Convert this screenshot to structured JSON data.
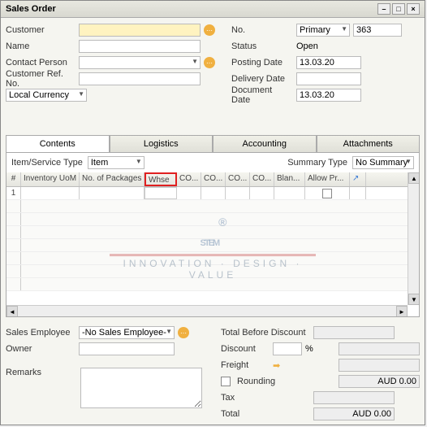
{
  "window": {
    "title": "Sales Order"
  },
  "header": {
    "left": {
      "customer_label": "Customer",
      "name_label": "Name",
      "contact_label": "Contact Person",
      "custref_label": "Customer Ref. No.",
      "currency_label": "Local Currency"
    },
    "right": {
      "no_label": "No.",
      "no_series": "Primary",
      "no_value": "363",
      "status_label": "Status",
      "status_value": "Open",
      "posting_label": "Posting Date",
      "posting_value": "13.03.20",
      "delivery_label": "Delivery Date",
      "document_label": "Document Date",
      "document_value": "13.03.20"
    }
  },
  "tabs": [
    "Contents",
    "Logistics",
    "Accounting",
    "Attachments"
  ],
  "gridbar": {
    "item_type_label": "Item/Service Type",
    "item_type_value": "Item",
    "summary_type_label": "Summary Type",
    "summary_type_value": "No Summary"
  },
  "grid": {
    "columns": [
      "#",
      "Inventory UoM",
      "No. of Packages",
      "Whse",
      "CO...",
      "CO...",
      "CO...",
      "CO...",
      "Blan...",
      "Allow Pr..."
    ],
    "rows": [
      {
        "num": "1"
      }
    ]
  },
  "footer": {
    "sales_emp_label": "Sales Employee",
    "sales_emp_value": "-No Sales Employee-",
    "owner_label": "Owner",
    "total_before_label": "Total Before Discount",
    "discount_label": "Discount",
    "discount_pct": "%",
    "freight_label": "Freight",
    "rounding_label": "Rounding",
    "rounding_value": "AUD 0.00",
    "tax_label": "Tax",
    "total_label": "Total",
    "total_value": "AUD 0.00",
    "remarks_label": "Remarks"
  },
  "watermark": {
    "brand": "STEM",
    "tag": "INNOVATION · DESIGN · VALUE"
  }
}
